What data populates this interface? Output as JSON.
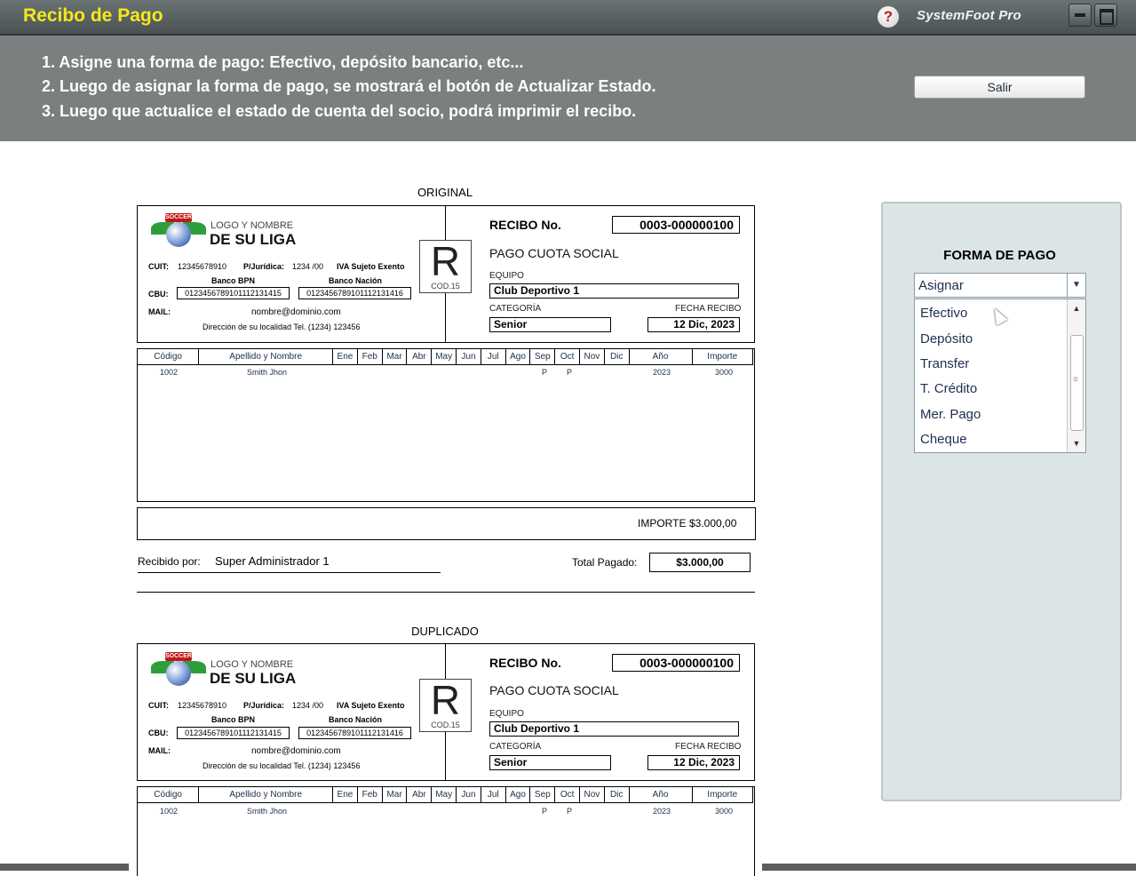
{
  "window": {
    "title": "Recibo de Pago",
    "brand": "SystemFoot Pro",
    "help_glyph": "?",
    "icons": [
      "help-icon",
      "minimize-icon",
      "maximize-icon"
    ]
  },
  "instructions": [
    "1. Asigne una forma de pago: Efectivo, depósito bancario, etc...",
    "2. Luego de asignar la forma de pago, se mostrará el botón de Actualizar Estado.",
    "3. Luego que actualice el estado de cuenta del socio, podrá imprimir el recibo."
  ],
  "salir_label": "Salir",
  "receipt": {
    "logo_line1": "LOGO Y NOMBRE",
    "logo_line2": "DE SU LIGA",
    "logo_badge": "SOCCER",
    "cuit_label": "CUIT:",
    "cuit": "12345678910",
    "pj_label": "P/Jurídica:",
    "pj": "1234 /00",
    "iva": "IVA Sujeto Exento",
    "bank1": "Banco BPN",
    "bank2": "Banco Nación",
    "cbu_label": "CBU:",
    "cbu1": "0123456789101112131415",
    "cbu2": "0123456789101112131416",
    "mail_label": "MAIL:",
    "mail": "nombre@dominio.com",
    "address": "Dirección de su localidad  Tel. (1234)  123456",
    "r_letter": "R",
    "r_code": "COD.15",
    "recibo_label": "RECIBO No.",
    "recibo_no": "0003-000000100",
    "concept": "PAGO CUOTA SOCIAL",
    "equipo_label": "EQUIPO",
    "equipo": "Club Deportivo 1",
    "categoria_label": "CATEGORÍA",
    "categoria": "Senior",
    "fecha_label": "FECHA RECIBO",
    "fecha": "12 Dic, 2023",
    "columns": [
      "Código",
      "Apellido y Nombre",
      "Ene",
      "Feb",
      "Mar",
      "Abr",
      "May",
      "Jun",
      "Jul",
      "Ago",
      "Sep",
      "Oct",
      "Nov",
      "Dic",
      "Año",
      "Importe"
    ],
    "row": {
      "codigo": "1002",
      "nombre": "Smith Jhon",
      "sep": "P",
      "oct": "P",
      "anio": "2023",
      "importe": "3000"
    },
    "importe_label": "IMPORTE",
    "importe_total": "$3.000,00",
    "recibido_label": "Recibido por:",
    "recibido_por": "Super Administrador 1",
    "total_label": "Total Pagado:",
    "total": "$3.000,00"
  },
  "copies": {
    "original": "ORIGINAL",
    "duplicado": "DUPLICADO"
  },
  "forma_pago": {
    "title": "FORMA DE PAGO",
    "selected": "Asignar",
    "options": [
      "Efectivo",
      "Depósito",
      "Transfer",
      "T. Crédito",
      "Mer. Pago",
      "Cheque"
    ]
  }
}
